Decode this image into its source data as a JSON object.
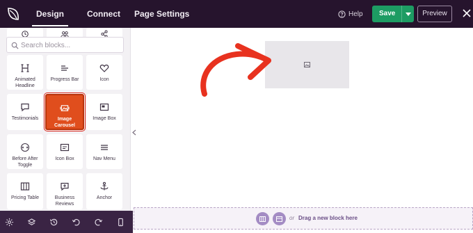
{
  "topbar": {
    "tabs": [
      {
        "label": "Design",
        "active": true
      },
      {
        "label": "Connect",
        "active": false
      },
      {
        "label": "Page Settings",
        "active": false
      }
    ],
    "help_label": "Help",
    "save_label": "Save",
    "preview_label": "Preview"
  },
  "sidebar": {
    "search_placeholder": "Search blocks...",
    "top_row_icons": [
      "countdown-icon",
      "team-icon",
      "share-icon"
    ],
    "blocks": [
      {
        "label": "Animated Headline",
        "icon": "heading-icon"
      },
      {
        "label": "Progress Bar",
        "icon": "progress-bar-icon"
      },
      {
        "label": "Icon",
        "icon": "heart-icon"
      },
      {
        "label": "Testimonials",
        "icon": "speech-bubble-icon"
      },
      {
        "label": "Image Carousel",
        "icon": "image-carousel-icon",
        "selected": true
      },
      {
        "label": "Image Box",
        "icon": "image-box-icon"
      },
      {
        "label": "Before After Toggle",
        "icon": "compare-icon"
      },
      {
        "label": "Icon Box",
        "icon": "icon-box-icon"
      },
      {
        "label": "Nav Menu",
        "icon": "menu-icon"
      },
      {
        "label": "Pricing Table",
        "icon": "pricing-table-icon"
      },
      {
        "label": "Business Reviews",
        "icon": "review-icon"
      },
      {
        "label": "Anchor",
        "icon": "anchor-icon"
      }
    ]
  },
  "bottom_toolbar": [
    "settings-icon",
    "layers-icon",
    "history-icon",
    "undo-icon",
    "redo-icon",
    "mobile-preview-icon"
  ],
  "canvas": {
    "dropzone_or": "or",
    "dropzone_text": "Drag a new block here"
  },
  "colors": {
    "topbar": "#26142d",
    "save": "#1d9c63",
    "selected_block": "#e04e1d",
    "arrow": "#e8321f",
    "dropzone_accent": "#a48cc4"
  }
}
